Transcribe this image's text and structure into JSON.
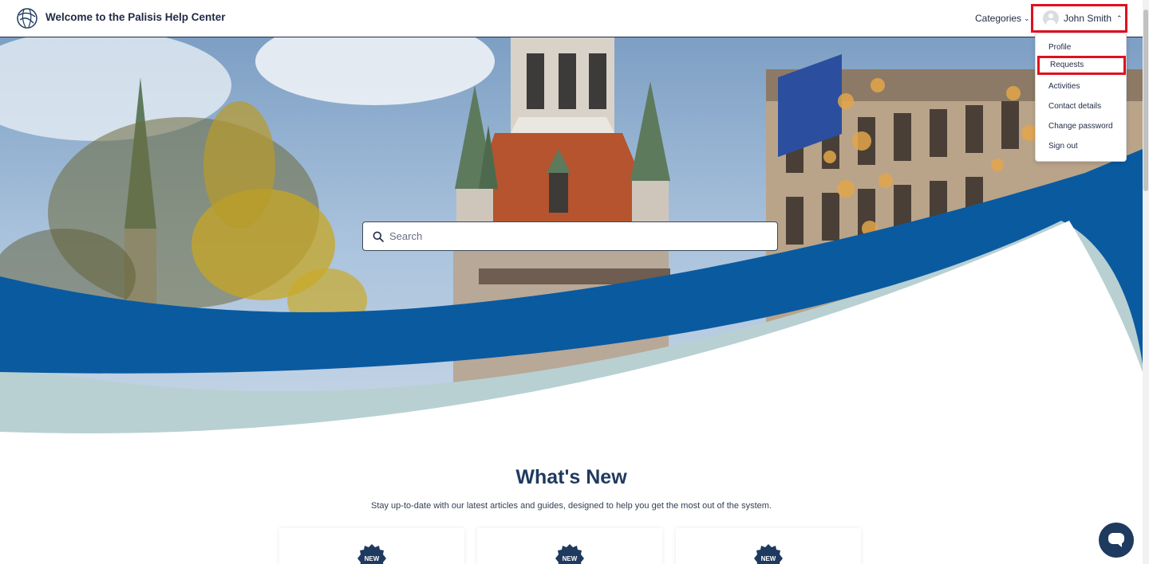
{
  "header": {
    "site_title": "Welcome to the Palisis Help Center",
    "categories_label": "Categories",
    "user_name": "John Smith"
  },
  "user_menu": {
    "items": [
      {
        "label": "Profile",
        "highlighted": false
      },
      {
        "label": "Requests",
        "highlighted": true
      },
      {
        "label": "Activities",
        "highlighted": false
      },
      {
        "label": "Contact details",
        "highlighted": false
      },
      {
        "label": "Change password",
        "highlighted": false
      },
      {
        "label": "Sign out",
        "highlighted": false
      }
    ]
  },
  "hero": {
    "search_placeholder": "Search"
  },
  "whats_new": {
    "title": "What's New",
    "subtitle": "Stay up-to-date with our latest articles and guides, designed to help you get the most out of the system.",
    "cards": [
      {
        "badge": "NEW"
      },
      {
        "badge": "NEW"
      },
      {
        "badge": "NEW"
      }
    ]
  },
  "colors": {
    "brand_navy": "#1f3a5f",
    "wave_blue": "#0a5aa0",
    "wave_light": "#b8d0d2",
    "highlight_red": "#e0101e"
  },
  "icons": {
    "logo": "palisis-globe-logo",
    "search": "search-icon",
    "chat": "chat-icon"
  }
}
